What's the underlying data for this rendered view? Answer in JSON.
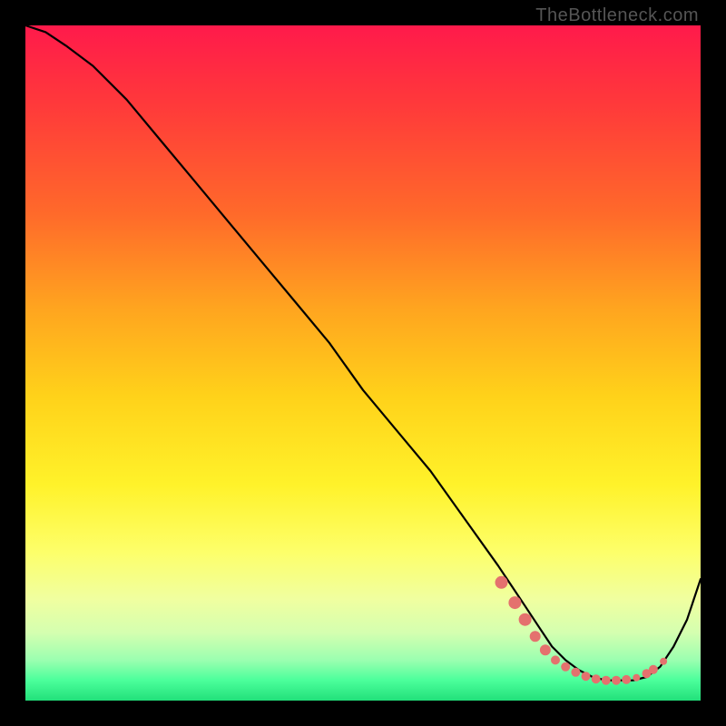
{
  "attribution": "TheBottleneck.com",
  "chart_data": {
    "type": "line",
    "title": "",
    "xlabel": "",
    "ylabel": "",
    "xlim": [
      0,
      100
    ],
    "ylim": [
      0,
      100
    ],
    "series": [
      {
        "name": "bottleneck-curve",
        "x": [
          0,
          3,
          6,
          10,
          15,
          20,
          25,
          30,
          35,
          40,
          45,
          50,
          55,
          60,
          65,
          70,
          72,
          74,
          76,
          78,
          80,
          82,
          84,
          86,
          88,
          90,
          92,
          94,
          96,
          98,
          100
        ],
        "values": [
          100,
          99,
          97,
          94,
          89,
          83,
          77,
          71,
          65,
          59,
          53,
          46,
          40,
          34,
          27,
          20,
          17,
          14,
          11,
          8,
          6,
          4.5,
          3.5,
          3,
          3,
          3,
          3.5,
          5,
          8,
          12,
          18
        ]
      }
    ],
    "markers": {
      "name": "highlighted-points",
      "color": "#e4716e",
      "points": [
        {
          "x": 70.5,
          "y": 17.5,
          "r": 7
        },
        {
          "x": 72.5,
          "y": 14.5,
          "r": 7
        },
        {
          "x": 74.0,
          "y": 12.0,
          "r": 7
        },
        {
          "x": 75.5,
          "y": 9.5,
          "r": 6
        },
        {
          "x": 77.0,
          "y": 7.5,
          "r": 6
        },
        {
          "x": 78.5,
          "y": 6.0,
          "r": 5
        },
        {
          "x": 80.0,
          "y": 5.0,
          "r": 5
        },
        {
          "x": 81.5,
          "y": 4.2,
          "r": 5
        },
        {
          "x": 83.0,
          "y": 3.6,
          "r": 5
        },
        {
          "x": 84.5,
          "y": 3.2,
          "r": 5
        },
        {
          "x": 86.0,
          "y": 3.0,
          "r": 5
        },
        {
          "x": 87.5,
          "y": 3.0,
          "r": 5
        },
        {
          "x": 89.0,
          "y": 3.1,
          "r": 5
        },
        {
          "x": 90.5,
          "y": 3.4,
          "r": 4
        },
        {
          "x": 92.0,
          "y": 4.0,
          "r": 5
        },
        {
          "x": 93.0,
          "y": 4.6,
          "r": 5
        },
        {
          "x": 94.5,
          "y": 5.8,
          "r": 4
        }
      ]
    }
  }
}
